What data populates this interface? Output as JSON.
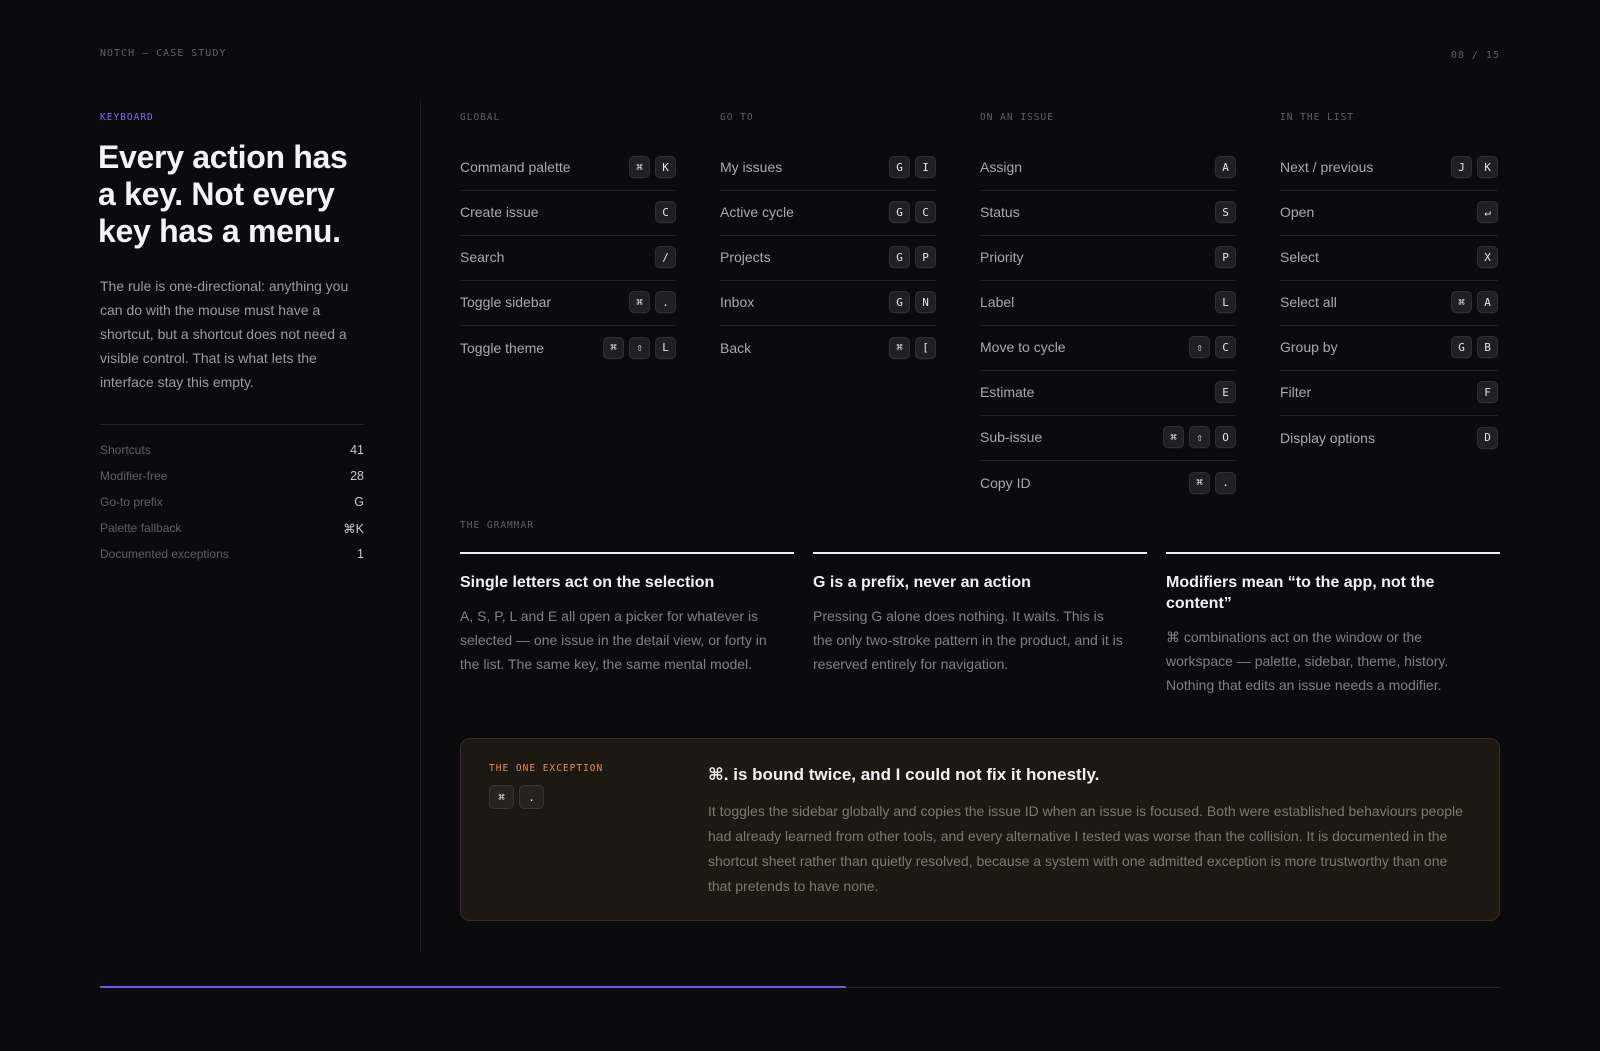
{
  "header": {
    "breadcrumb": "NOTCH — CASE STUDY",
    "page_indicator": "08 / 15"
  },
  "intro": {
    "eyebrow": "KEYBOARD",
    "headline": "Every action has a key. Not every key has a menu.",
    "lede": "The rule is one-directional: anything you can do with the mouse must have a shortcut, but a shortcut does not need a visible control. That is what lets the interface stay this empty.",
    "stats": [
      {
        "label": "Shortcuts",
        "value": "41"
      },
      {
        "label": "Modifier-free",
        "value": "28"
      },
      {
        "label": "Go-to prefix",
        "value": "G"
      },
      {
        "label": "Palette fallback",
        "value": "⌘K"
      },
      {
        "label": "Documented exceptions",
        "value": "1"
      }
    ]
  },
  "shortcut_groups": [
    {
      "title": "GLOBAL",
      "items": [
        {
          "label": "Command palette",
          "keys": [
            "⌘",
            "K"
          ]
        },
        {
          "label": "Create issue",
          "keys": [
            "C"
          ]
        },
        {
          "label": "Search",
          "keys": [
            "/"
          ]
        },
        {
          "label": "Toggle sidebar",
          "keys": [
            "⌘",
            "."
          ]
        },
        {
          "label": "Toggle theme",
          "keys": [
            "⌘",
            "⇧",
            "L"
          ]
        }
      ]
    },
    {
      "title": "GO TO",
      "items": [
        {
          "label": "My issues",
          "keys": [
            "G",
            "I"
          ]
        },
        {
          "label": "Active cycle",
          "keys": [
            "G",
            "C"
          ]
        },
        {
          "label": "Projects",
          "keys": [
            "G",
            "P"
          ]
        },
        {
          "label": "Inbox",
          "keys": [
            "G",
            "N"
          ]
        },
        {
          "label": "Back",
          "keys": [
            "⌘",
            "["
          ]
        }
      ]
    },
    {
      "title": "ON AN ISSUE",
      "items": [
        {
          "label": "Assign",
          "keys": [
            "A"
          ]
        },
        {
          "label": "Status",
          "keys": [
            "S"
          ]
        },
        {
          "label": "Priority",
          "keys": [
            "P"
          ]
        },
        {
          "label": "Label",
          "keys": [
            "L"
          ]
        },
        {
          "label": "Move to cycle",
          "keys": [
            "⇧",
            "C"
          ]
        },
        {
          "label": "Estimate",
          "keys": [
            "E"
          ]
        },
        {
          "label": "Sub-issue",
          "keys": [
            "⌘",
            "⇧",
            "O"
          ]
        },
        {
          "label": "Copy ID",
          "keys": [
            "⌘",
            "."
          ]
        }
      ]
    },
    {
      "title": "IN THE LIST",
      "items": [
        {
          "label": "Next / previous",
          "keys": [
            "J",
            "K"
          ]
        },
        {
          "label": "Open",
          "keys": [
            "↵"
          ]
        },
        {
          "label": "Select",
          "keys": [
            "X"
          ]
        },
        {
          "label": "Select all",
          "keys": [
            "⌘",
            "A"
          ]
        },
        {
          "label": "Group by",
          "keys": [
            "G",
            "B"
          ]
        },
        {
          "label": "Filter",
          "keys": [
            "F"
          ]
        },
        {
          "label": "Display options",
          "keys": [
            "D"
          ]
        }
      ]
    }
  ],
  "grammar": {
    "title": "THE GRAMMAR",
    "cards": [
      {
        "title": "Single letters act on the selection",
        "body": "A, S, P, L and E all open a picker for whatever is selected — one issue in the detail view, or forty in the list. The same key, the same mental model."
      },
      {
        "title": "G is a prefix, never an action",
        "body": "Pressing G alone does nothing. It waits. This is the only two-stroke pattern in the product, and it is reserved entirely for navigation."
      },
      {
        "title": "Modifiers mean “to the app, not the content”",
        "body": "⌘ combinations act on the window or the workspace — palette, sidebar, theme, history. Nothing that edits an issue needs a modifier."
      }
    ]
  },
  "exception": {
    "label": "THE ONE EXCEPTION",
    "keys": [
      "⌘",
      "."
    ],
    "title": "⌘. is bound twice, and I could not fix it honestly.",
    "body": "It toggles the sidebar globally and copies the issue ID when an issue is focused. Both were established behaviours people had already learned from other tools, and every alternative I tested was worse than the collision. It is documented in the shortcut sheet rather than quietly resolved, because a system with one admitted exception is more trustworthy than one that pretends to have none."
  },
  "progress": {
    "fraction": 0.533,
    "accent": "#6b5ae8"
  }
}
